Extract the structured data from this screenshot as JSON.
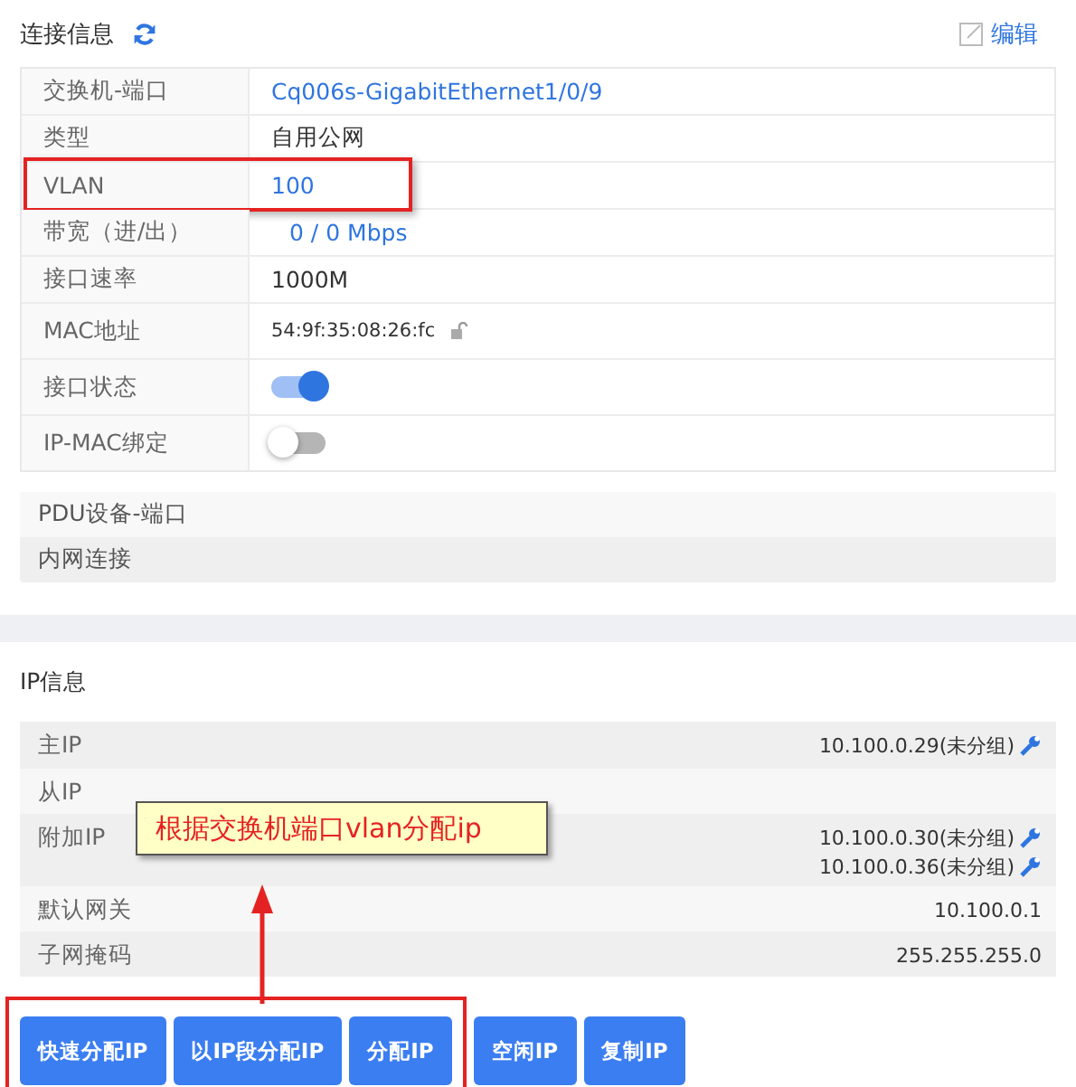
{
  "connection": {
    "title": "连接信息",
    "edit_label": "编辑",
    "rows": [
      {
        "label": "交换机-端口",
        "kind": "link",
        "value": "Cq006s-GigabitEthernet1/0/9"
      },
      {
        "label": "类型",
        "kind": "text",
        "value": "自用公网"
      },
      {
        "label": "VLAN",
        "kind": "link",
        "value": "100",
        "highlighted": true
      },
      {
        "label": "带宽（进/出）",
        "kind": "link",
        "value": "0 / 0 Mbps",
        "indent": true
      },
      {
        "label": "接口速率",
        "kind": "text",
        "value": "1000M"
      },
      {
        "label": "MAC地址",
        "kind": "mac",
        "value": "54:9f:35:08:26:fc"
      },
      {
        "label": "接口状态",
        "kind": "toggle",
        "on": true
      },
      {
        "label": "IP-MAC绑定",
        "kind": "toggle",
        "on": false
      }
    ],
    "extra_rows": [
      "PDU设备-端口",
      "内网连接"
    ]
  },
  "ip_info": {
    "title": "IP信息",
    "rows": [
      {
        "label": "主IP",
        "values": [
          "10.100.0.29(未分组)"
        ],
        "editable": true
      },
      {
        "label": "从IP",
        "values": [],
        "editable": false
      },
      {
        "label": "附加IP",
        "values": [
          "10.100.0.30(未分组)",
          "10.100.0.36(未分组)"
        ],
        "editable": true
      },
      {
        "label": "默认网关",
        "values": [
          "10.100.0.1"
        ],
        "editable": false
      },
      {
        "label": "子网掩码",
        "values": [
          "255.255.255.0"
        ],
        "editable": false
      }
    ],
    "buttons": [
      {
        "label": "快速分配IP",
        "highlighted": true
      },
      {
        "label": "以IP段分配IP",
        "highlighted": true
      },
      {
        "label": "分配IP",
        "highlighted": true
      },
      {
        "label": "空闲IP",
        "highlighted": false
      },
      {
        "label": "复制IP",
        "highlighted": false
      }
    ]
  },
  "annotation": {
    "text": "根据交换机端口vlan分配ip"
  }
}
